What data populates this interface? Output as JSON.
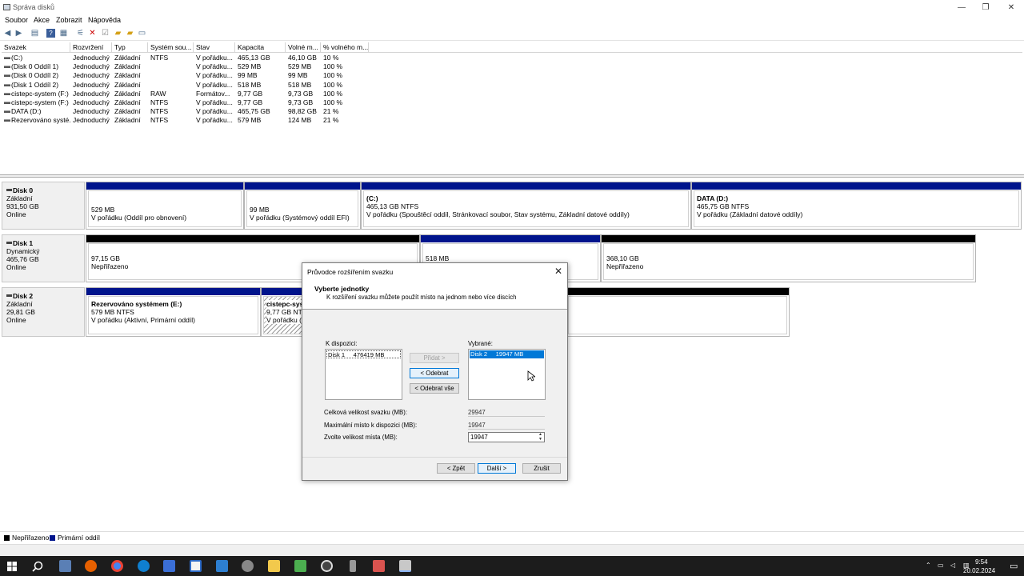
{
  "window": {
    "title": "Správa disků",
    "minimize": "—",
    "restore": "❐",
    "close": "✕"
  },
  "menu": [
    "Soubor",
    "Akce",
    "Zobrazit",
    "Nápověda"
  ],
  "toolbar_icons": [
    "back-icon",
    "forward-icon",
    "view-icon",
    "help-icon",
    "properties-icon",
    "connect-icon",
    "delete-icon",
    "check-icon",
    "folder-up-icon",
    "folder-icon",
    "list-icon"
  ],
  "volumes": {
    "headers": [
      "Svazek",
      "Rozvržení",
      "Typ",
      "Systém sou...",
      "Stav",
      "Kapacita",
      "Volné m...",
      "% volného m..."
    ],
    "rows": [
      [
        "(C:)",
        "Jednoduchý",
        "Základní",
        "NTFS",
        "V pořádku...",
        "465,13 GB",
        "46,10 GB",
        "10 %"
      ],
      [
        "(Disk 0 Oddíl 1)",
        "Jednoduchý",
        "Základní",
        "",
        "V pořádku...",
        "529 MB",
        "529 MB",
        "100 %"
      ],
      [
        "(Disk 0 Oddíl 2)",
        "Jednoduchý",
        "Základní",
        "",
        "V pořádku...",
        "99 MB",
        "99 MB",
        "100 %"
      ],
      [
        "(Disk 1 Oddíl 2)",
        "Jednoduchý",
        "Základní",
        "",
        "V pořádku...",
        "518 MB",
        "518 MB",
        "100 %"
      ],
      [
        "cistepc-system (F:)",
        "Jednoduchý",
        "Základní",
        "RAW",
        "Formátov...",
        "9,77 GB",
        "9,73 GB",
        "100 %"
      ],
      [
        "cistepc-system (F:)",
        "Jednoduchý",
        "Základní",
        "NTFS",
        "V pořádku...",
        "9,77 GB",
        "9,73 GB",
        "100 %"
      ],
      [
        "DATA (D:)",
        "Jednoduchý",
        "Základní",
        "NTFS",
        "V pořádku...",
        "465,75 GB",
        "98,82 GB",
        "21 %"
      ],
      [
        "Rezervováno systé...",
        "Jednoduchý",
        "Základní",
        "NTFS",
        "V pořádku...",
        "579 MB",
        "124 MB",
        "21 %"
      ]
    ]
  },
  "disks": [
    {
      "name": "Disk 0",
      "type": "Základní",
      "size": "931,50 GB",
      "status": "Online",
      "partitions": [
        {
          "title": "",
          "size": "529 MB",
          "desc": "V pořádku (Oddíl pro obnovení)"
        },
        {
          "title": "",
          "size": "99 MB",
          "desc": "V pořádku (Systémový oddíl EFI)"
        },
        {
          "title": "(C:)",
          "size": "465,13 GB NTFS",
          "desc": "V pořádku (Spouštěcí oddíl, Stránkovací soubor, Stav systému, Základní datové oddíly)"
        },
        {
          "title": "DATA  (D:)",
          "size": "465,75 GB NTFS",
          "desc": "V pořádku (Základní datové oddíly)"
        }
      ]
    },
    {
      "name": "Disk 1",
      "type": "Dynamický",
      "size": "465,76 GB",
      "status": "Online",
      "partitions": [
        {
          "title": "",
          "size": "97,15 GB",
          "desc": "Nepřiřazeno"
        },
        {
          "title": "",
          "size": "518 MB",
          "desc": ""
        },
        {
          "title": "",
          "size": "368,10 GB",
          "desc": "Nepřiřazeno"
        }
      ]
    },
    {
      "name": "Disk 2",
      "type": "Základní",
      "size": "29,81 GB",
      "status": "Online",
      "partitions": [
        {
          "title": "Rezervováno systémem  (E:)",
          "size": "579 MB NTFS",
          "desc": "V pořádku (Aktivní, Primární oddíl)"
        },
        {
          "title": "cistepc-syste",
          "size": "9,77 GB NTFS",
          "desc": "V pořádku (Pr"
        },
        {
          "title": "",
          "size": "",
          "desc": ""
        }
      ]
    }
  ],
  "legend": [
    {
      "label": "Nepřiřazeno",
      "color": "#000000"
    },
    {
      "label": "Primární oddíl",
      "color": "#00148c"
    }
  ],
  "dialog": {
    "title": "Průvodce rozšířením svazku",
    "heading": "Vyberte jednotky",
    "subtitle": "K rozšíření svazku můžete použít místo na jednom nebo více discích",
    "available_label": "K dispozici:",
    "available_items": [
      "Disk 1     476419 MB"
    ],
    "selected_label": "Vybrané:",
    "selected_items": [
      "Disk 2     19947 MB"
    ],
    "add_button": "Přidat >",
    "remove_button": "< Odebrat",
    "remove_all_button": "< Odebrat vše",
    "total_size_label": "Celková velikost svazku (MB):",
    "total_size_value": "29947",
    "max_space_label": "Maximální místo k dispozici (MB):",
    "max_space_value": "19947",
    "choose_size_label": "Zvolte velikost místa (MB):",
    "choose_size_value": "19947",
    "back_button": "< Zpět",
    "next_button": "Další >",
    "cancel_button": "Zrušit"
  },
  "taskbar": {
    "time": "9:54",
    "date": "20.02.2024"
  }
}
